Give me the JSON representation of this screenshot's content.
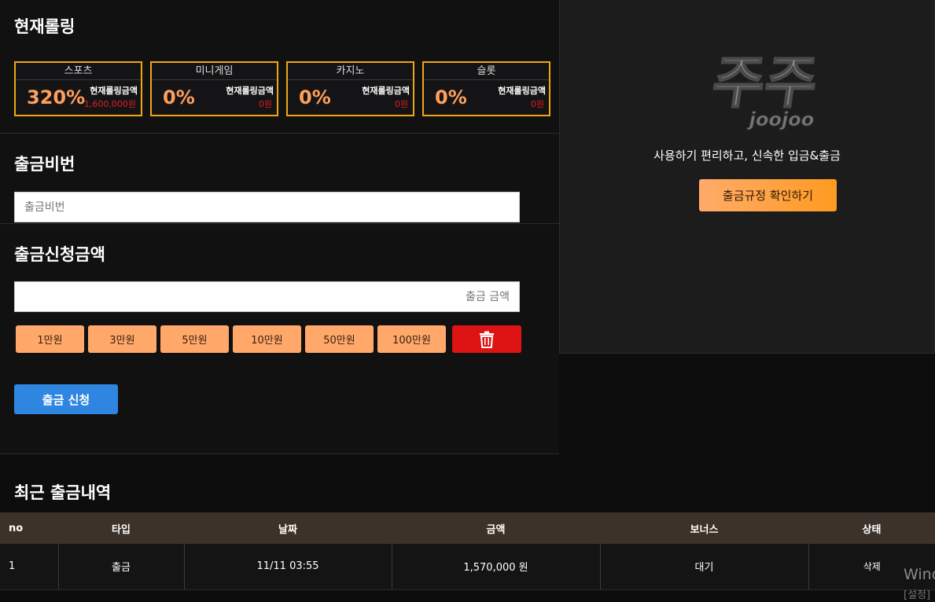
{
  "rolling": {
    "title": "현재롤링",
    "items": [
      {
        "name": "스포츠",
        "percent": "320%",
        "label": "현재롤링금액",
        "amount": "1,600,000원"
      },
      {
        "name": "미니게임",
        "percent": "0%",
        "label": "현재롤링금액",
        "amount": "0원"
      },
      {
        "name": "카지노",
        "percent": "0%",
        "label": "현재롤링금액",
        "amount": "0원"
      },
      {
        "name": "슬롯",
        "percent": "0%",
        "label": "현재롤링금액",
        "amount": "0원"
      }
    ]
  },
  "pin": {
    "title": "출금비번",
    "placeholder": "출금비번"
  },
  "amount": {
    "title": "출금신청금액",
    "placeholder": "출금 금액",
    "chips": [
      "1만원",
      "3만원",
      "5만원",
      "10만원",
      "50만원",
      "100만원"
    ],
    "submit_label": "출금 신청"
  },
  "promo": {
    "logo_text": "주주",
    "logo_sub": "joojoo",
    "tagline": "사용하기 편리하고, 신속한 입금&출금",
    "rule_button": "출금규정 확인하기"
  },
  "history": {
    "title": "최근 출금내역",
    "columns": [
      "no",
      "타입",
      "날짜",
      "금액",
      "보너스",
      "상태"
    ],
    "rows": [
      {
        "no": "1",
        "type": "출금",
        "date": "11/11 03:55",
        "amount": "1,570,000 원",
        "bonus": "대기",
        "state": "삭제"
      }
    ]
  },
  "watermark": {
    "line1": "Wind",
    "line2": "[설정]"
  },
  "colors": {
    "accent": "#ffa86a",
    "border": "#f0a70f",
    "danger": "#de1414",
    "primary": "#2f86e0"
  }
}
